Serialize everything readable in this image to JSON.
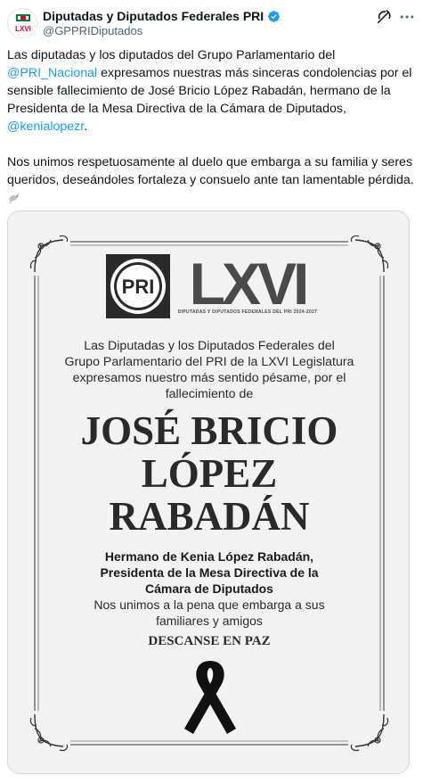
{
  "account": {
    "display_name": "Diputadas y Diputados Federales PRI",
    "handle": "@GPPRIDiputados",
    "avatar_icon": "pri-lxvi-logo",
    "avatar_text": "LXVI",
    "verified_color": "#1d9bf0"
  },
  "actions": {
    "grok_icon": "grok-icon",
    "more_icon": "more-dots-icon"
  },
  "tweet": {
    "p1_a": "Las diputadas y los diputados del Grupo Parlamentario del ",
    "p1_mention": "@PRI_Nacional",
    "p1_b": " expresamos nuestras más sinceras condolencias por el sensible fallecimiento de José Bricio López Rabadán, hermano de la Presidenta de la Mesa Directiva de la Cámara de Diputados, ",
    "p1_mention2": "@kenialopezr",
    "p1_c": ".",
    "p2": "Nos unimos respetuosamente al duelo que embarga a su familia y seres queridos, deseándoles fortaleza y consuelo ante tan lamentable pérdida.",
    "p2_emoji": "dove-icon",
    "mention_color": "#1d9bf0"
  },
  "card": {
    "pri_logo_text": "PRI",
    "lxvi_text": "LXVI",
    "lxvi_subtitle": "DIPUTADAS Y DIPUTADOS FEDERALES DEL PRI 2024-2027",
    "intro_line1": "Las Diputadas y los Diputados Federales del",
    "intro_line2": "Grupo Parlamentario del PRI de la LXVI Legislatura",
    "intro_line3": "expresamos nuestro más sentido pésame, por el",
    "intro_line4": "fallecimiento de",
    "name_line1": "JOSÉ BRICIO",
    "name_line2": "LÓPEZ",
    "name_line3": "RABADÁN",
    "relation_line1": "Hermano de Kenia López Rabadán,",
    "relation_line2": "Presidenta de la Mesa Directiva de la",
    "relation_line3": "Cámara de Diputados",
    "condolence_line1": "Nos unimos a la pena que embarga a sus",
    "condolence_line2": "familiares y amigos",
    "rip": "DESCANSE EN PAZ",
    "ribbon_icon": "mourning-ribbon-icon",
    "background_color": "#f2f2f2"
  }
}
